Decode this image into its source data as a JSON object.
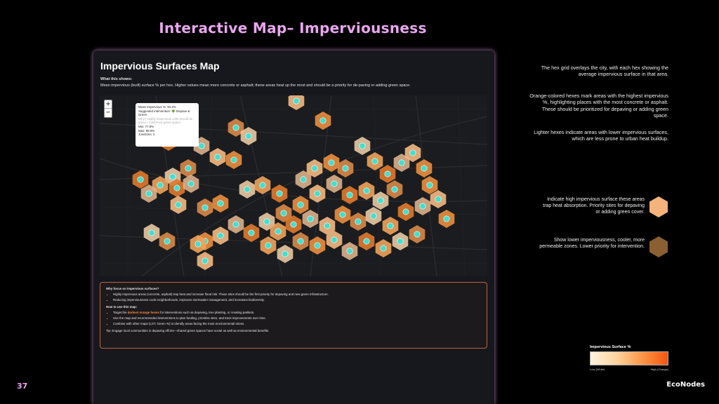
{
  "slide": {
    "title": "Interactive Map– Imperviousness",
    "page_number": "37",
    "brand": "EcoNodes"
  },
  "panel": {
    "title": "Impervious Surfaces Map",
    "what_label": "What this shows:",
    "what_desc": "Mean impervious (built) surface % per hex. Higher values mean more concrete or asphalt; these areas heat up the most and should be a priority for de-paving or adding green space.",
    "zoom_in": "+",
    "zoom_out": "−",
    "popup": {
      "line1": "Mean Impervious %: 94.2%",
      "line2": "Suggested intervention: 🌳 Depave & Green",
      "line3": "Why? Highly impervious cells should be green / reinforced green space.",
      "line4": "Min: 77.9%",
      "line5": "Max: 99.9%",
      "line6": "Junctions: 2"
    }
  },
  "notes": {
    "heading": "Why focus on impervious surfaces?",
    "bullets": [
      "Highly impervious areas (concrete, asphalt) trap heat and increase flood risk. These sites should be the first priority for depaving and new green infrastructure.",
      "Reducing imperviousness cools neighborhoods, improves stormwater management, and increases biodiversity."
    ],
    "howto_heading": "How to use this map:",
    "howto_pre": "Target the ",
    "howto_highlight": "darkest orange hexes",
    "howto_post": " for interventions such as depaving, tree planting, or creating parklets.",
    "howto_bullets": [
      "Use the map and recommended interventions to plan funding, prioritise sites, and track improvements over time.",
      "Combine with other maps (LST, Green %) to identify areas facing the most environmental stress."
    ],
    "tip": "Tip: Engage local communities in depaving efforts—shared green spaces have social as well as environmental benefits."
  },
  "explanations": {
    "p1": "The hex grid overlays the city, with each hex showing the average impervious surface in that area.",
    "p2": "Orange-colored hexes mark areas with the highest impervious %, highlighting places with the most concrete or asphalt. These should be prioritized for depaving or adding green space.",
    "p3": "Lighter hexes indicate areas with lower impervious surfaces, which are less prone to urban heat buildup."
  },
  "legend": {
    "high_text": "Indicate high impervious surface these areas trap heat absorption. Priority sites for depaving or adding green cover.",
    "high_color": "#f5b27a",
    "low_text": "Show lower imperviousness, cooler, more permeable zones. Lower priority for intervention.",
    "low_color": "#8a6033"
  },
  "scale": {
    "title": "Impervious Surface %",
    "low_label": "Low (White)",
    "high_label": "High (Orange)",
    "colors": [
      "#fff3e0",
      "#fdd39b",
      "#fb9a4b",
      "#f4560f"
    ]
  },
  "colors": {
    "accent": "#e9a6ef",
    "hex_orange": "#e87a2e",
    "hex_light": "#e8c49a",
    "marker": "#3ee0d0"
  }
}
